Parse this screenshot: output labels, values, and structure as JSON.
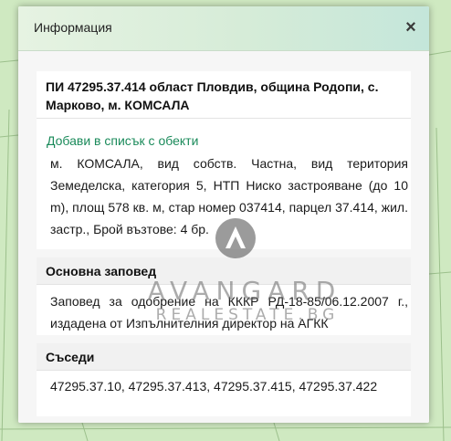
{
  "dialog": {
    "title": "Информация",
    "close_glyph": "×"
  },
  "parcel": {
    "heading": "ПИ 47295.37.414 област Пловдив, община Родопи, с. Марково, м. КОМСАЛА",
    "add_link": "Добави в списък с обекти",
    "description": "м. КОМСАЛА, вид собств. Частна, вид територия Земеделска, категория 5, НТП Ниско застрояване (до 10 m), площ 578 кв. м, стар номер 037414, парцел 37.414, жил. застр., Брой възтове: 4 бр."
  },
  "order": {
    "heading": "Основна заповед",
    "text": "Заповед за одобрение на КККР РД-18-85/06.12.2007 г., издадена от Изпълнителния директор на АГКК"
  },
  "neighbors": {
    "heading": "Съседи",
    "text": "47295.37.10, 47295.37.413, 47295.37.415, 47295.37.422"
  },
  "watermark": {
    "brand": "AVANGARD",
    "sub": "REALESTATE.BG"
  },
  "colors": {
    "map_background": "#cfe9c1",
    "link": "#1a8a5a",
    "header_gradient_start": "#e6f3e2",
    "header_gradient_end": "#c4e6da"
  },
  "icons": {
    "close": "close-icon",
    "watermark_logo": "avangard-logo-icon"
  }
}
